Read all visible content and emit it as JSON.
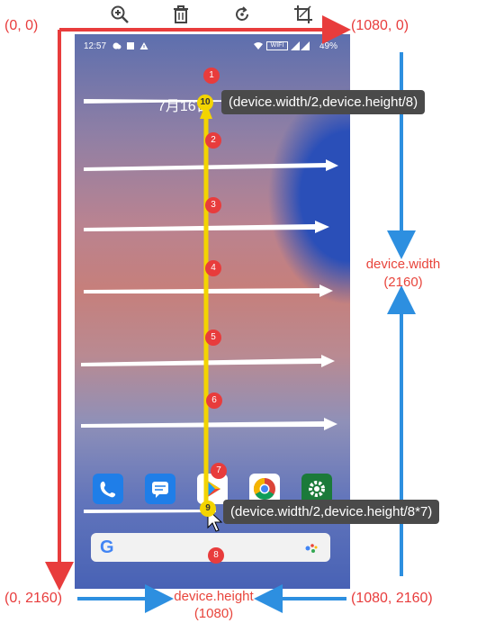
{
  "toolbar": {
    "icons": [
      "zoom-in-icon",
      "trash-icon",
      "rotate-icon",
      "crop-icon"
    ]
  },
  "status": {
    "time": "12:57",
    "battery": "49%",
    "net": "WIFI"
  },
  "clock": {
    "text": "7月16日"
  },
  "labels": {
    "top_left": "(0, 0)",
    "top_right": "(1080, 0)",
    "bottom_left": "(0, 2160)",
    "bottom_right": "(1080, 2160)",
    "right_width": "device.width",
    "right_width_value": "(2160)",
    "bottom_height": "device.height",
    "bottom_height_value": "(1080)",
    "tooltip_top": "(device.width/2,device.height/8)",
    "tooltip_bottom": "(device.width/2,device.height/8*7)"
  },
  "markers": [
    "1",
    "2",
    "3",
    "4",
    "5",
    "6",
    "7",
    "8",
    "9",
    "10"
  ],
  "colors": {
    "red_arrow": "#e83c3c",
    "blue_arrow": "#2d8fe0",
    "yellow_line": "#f3d400"
  }
}
